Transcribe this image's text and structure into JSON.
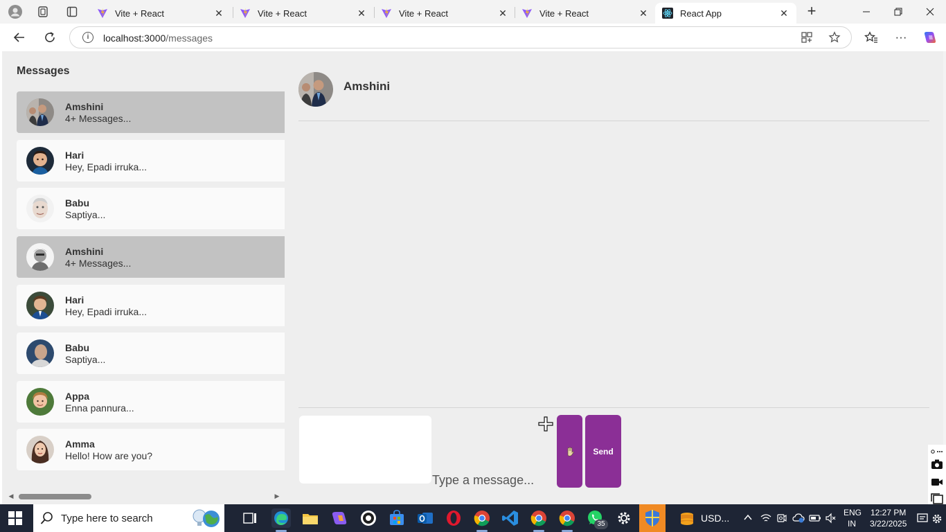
{
  "browser": {
    "tabs": [
      {
        "title": "Vite + React",
        "active": false
      },
      {
        "title": "Vite + React",
        "active": false
      },
      {
        "title": "Vite + React",
        "active": false
      },
      {
        "title": "Vite + React",
        "active": false
      },
      {
        "title": "React App",
        "active": true
      }
    ],
    "url_host": "localhost:3000",
    "url_path": "/messages"
  },
  "sidebar": {
    "title": "Messages",
    "contacts": [
      {
        "name": "Amshini",
        "last": "4+ Messages...",
        "highlighted": true
      },
      {
        "name": "Hari",
        "last": "Hey, Epadi irruka...",
        "highlighted": false
      },
      {
        "name": "Babu",
        "last": "Saptiya...",
        "highlighted": false
      },
      {
        "name": "Amshini",
        "last": "4+ Messages...",
        "highlighted": true
      },
      {
        "name": "Hari",
        "last": "Hey, Epadi irruka...",
        "highlighted": false
      },
      {
        "name": "Babu",
        "last": "Saptiya...",
        "highlighted": false
      },
      {
        "name": "Appa",
        "last": "Enna pannura...",
        "highlighted": false
      },
      {
        "name": "Amma",
        "last": "Hello! How are you?",
        "highlighted": false
      }
    ]
  },
  "chat": {
    "contact_name": "Amshini",
    "placeholder": "Type a message...",
    "send_label": "Send"
  },
  "taskbar": {
    "search_placeholder": "Type here to search",
    "whatsapp_badge": "35",
    "usd_label": "USD...",
    "lang_line1": "ENG",
    "lang_line2": "IN",
    "time": "12:27 PM",
    "date": "3/22/2025"
  },
  "colors": {
    "accent_purple": "#8b2f96",
    "highlight_gray": "#c2c2c2",
    "page_bg": "#eeeeee",
    "taskbar_bg": "#1e2535"
  }
}
